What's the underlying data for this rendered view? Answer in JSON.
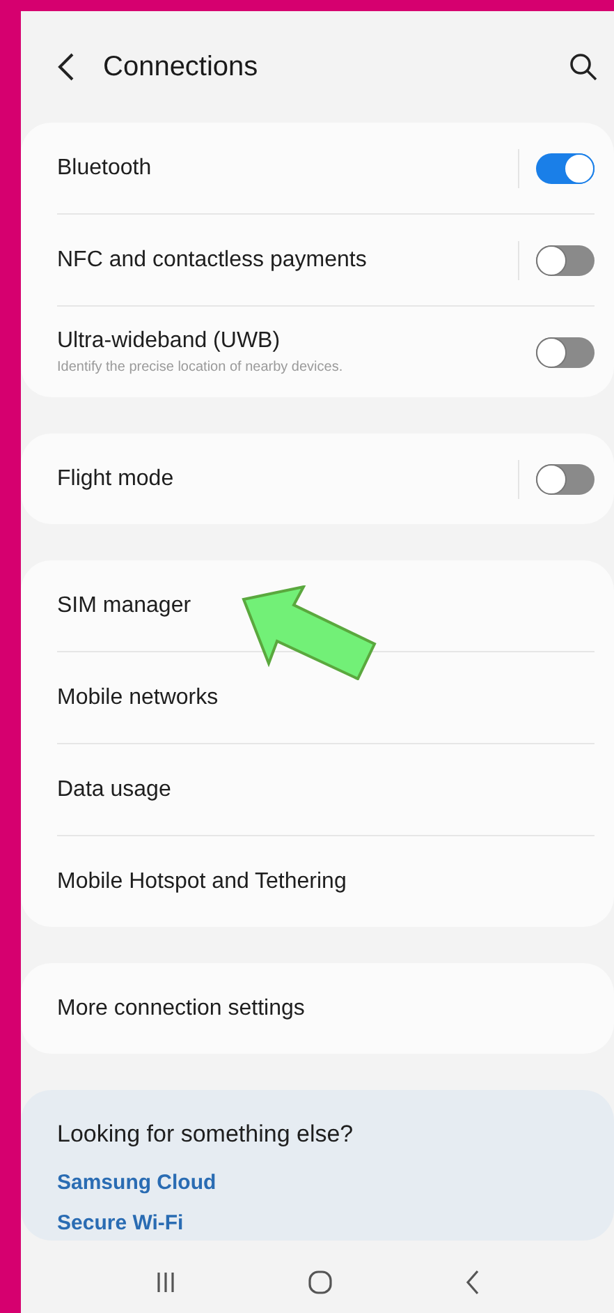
{
  "header": {
    "title": "Connections"
  },
  "groups": [
    {
      "items": [
        {
          "kind": "toggle",
          "label": "Bluetooth",
          "on": true
        },
        {
          "kind": "toggle",
          "label": "NFC and contactless payments",
          "on": false
        },
        {
          "kind": "toggle",
          "label": "Ultra-wideband (UWB)",
          "subtitle": "Identify the precise location of nearby devices.",
          "on": false
        }
      ]
    },
    {
      "items": [
        {
          "kind": "toggle",
          "label": "Flight mode",
          "on": false
        }
      ]
    },
    {
      "items": [
        {
          "kind": "link",
          "label": "SIM manager"
        },
        {
          "kind": "link",
          "label": "Mobile networks"
        },
        {
          "kind": "link",
          "label": "Data usage"
        },
        {
          "kind": "link",
          "label": "Mobile Hotspot and Tethering"
        }
      ]
    },
    {
      "items": [
        {
          "kind": "link",
          "label": "More connection settings"
        }
      ]
    }
  ],
  "suggestions": {
    "title": "Looking for something else?",
    "links": [
      "Samsung Cloud",
      "Secure Wi-Fi"
    ]
  }
}
